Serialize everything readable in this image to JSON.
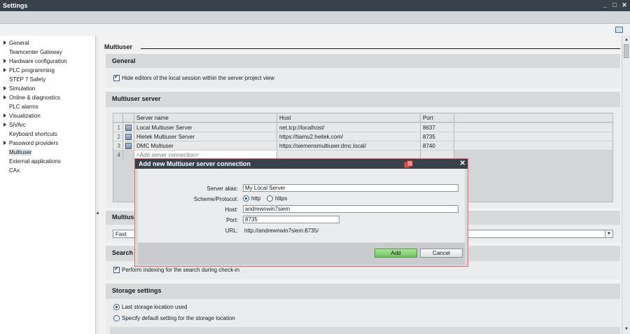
{
  "window": {
    "title": "Settings",
    "controls": [
      "_",
      "□",
      "✕"
    ]
  },
  "sidebar": {
    "items": [
      {
        "label": "General",
        "expandable": true
      },
      {
        "label": "Teamcenter Gateway",
        "expandable": false
      },
      {
        "label": "Hardware configuration",
        "expandable": true
      },
      {
        "label": "PLC programming",
        "expandable": true
      },
      {
        "label": "STEP 7 Safety",
        "expandable": false
      },
      {
        "label": "Simulation",
        "expandable": true
      },
      {
        "label": "Online & diagnostics",
        "expandable": true
      },
      {
        "label": "PLC alarms",
        "expandable": false
      },
      {
        "label": "Visualization",
        "expandable": true
      },
      {
        "label": "SiVArc",
        "expandable": true
      },
      {
        "label": "Keyboard shortcuts",
        "expandable": false
      },
      {
        "label": "Password providers",
        "expandable": true
      },
      {
        "label": "Multiuser",
        "expandable": false,
        "selected": true
      },
      {
        "label": "External applications",
        "expandable": false
      },
      {
        "label": "CAx",
        "expandable": false
      }
    ]
  },
  "content": {
    "page_title": "Multiuser",
    "general": {
      "heading": "General",
      "hide_editors_label": "Hide editors of the local session within the server project view"
    },
    "server": {
      "heading": "Multiuser server",
      "columns": [
        "Server name",
        "Host",
        "Port"
      ],
      "rows": [
        {
          "num": "1",
          "name": "Local Multiuser Server",
          "host": "net.tcp://localhost/",
          "port": "8637"
        },
        {
          "num": "2",
          "name": "Hietek Multiuser Server",
          "host": "https://tiamu2.heitek.com/",
          "port": "8735"
        },
        {
          "num": "3",
          "name": "DMC Multiuser",
          "host": "https://siemensmultiuser.dmc.local/",
          "port": "8740"
        }
      ],
      "new_row": {
        "num": "4",
        "placeholder": "<Add server connection>"
      }
    },
    "multiuser_partial": {
      "heading": "Multius",
      "dropdown_value": "Fast"
    },
    "search": {
      "heading": "Search",
      "indexing_label": "Perform indexing for the search during check-in"
    },
    "storage": {
      "heading": "Storage settings",
      "option_last": "Last storage location used",
      "option_default": "Specify default setting for the storage location"
    }
  },
  "dialog": {
    "title": "Add new Multiuser server connection",
    "alias_label": "Server alias:",
    "alias_value": "My Local Server",
    "scheme_label": "Scheme/Protocol:",
    "scheme_http": "http",
    "scheme_https": "https",
    "host_label": "Host:",
    "host_value": "andrewnwin7siem",
    "port_label": "Port:",
    "port_value": "8735",
    "url_label": "URL:",
    "url_value": "http://andrewnwin7siem:8735/",
    "add_label": "Add",
    "cancel_label": "Cancel"
  },
  "colors": {
    "titlebar": "#39414a",
    "add_button": "#6fc45e",
    "dialog_border": "#e46a6a"
  }
}
